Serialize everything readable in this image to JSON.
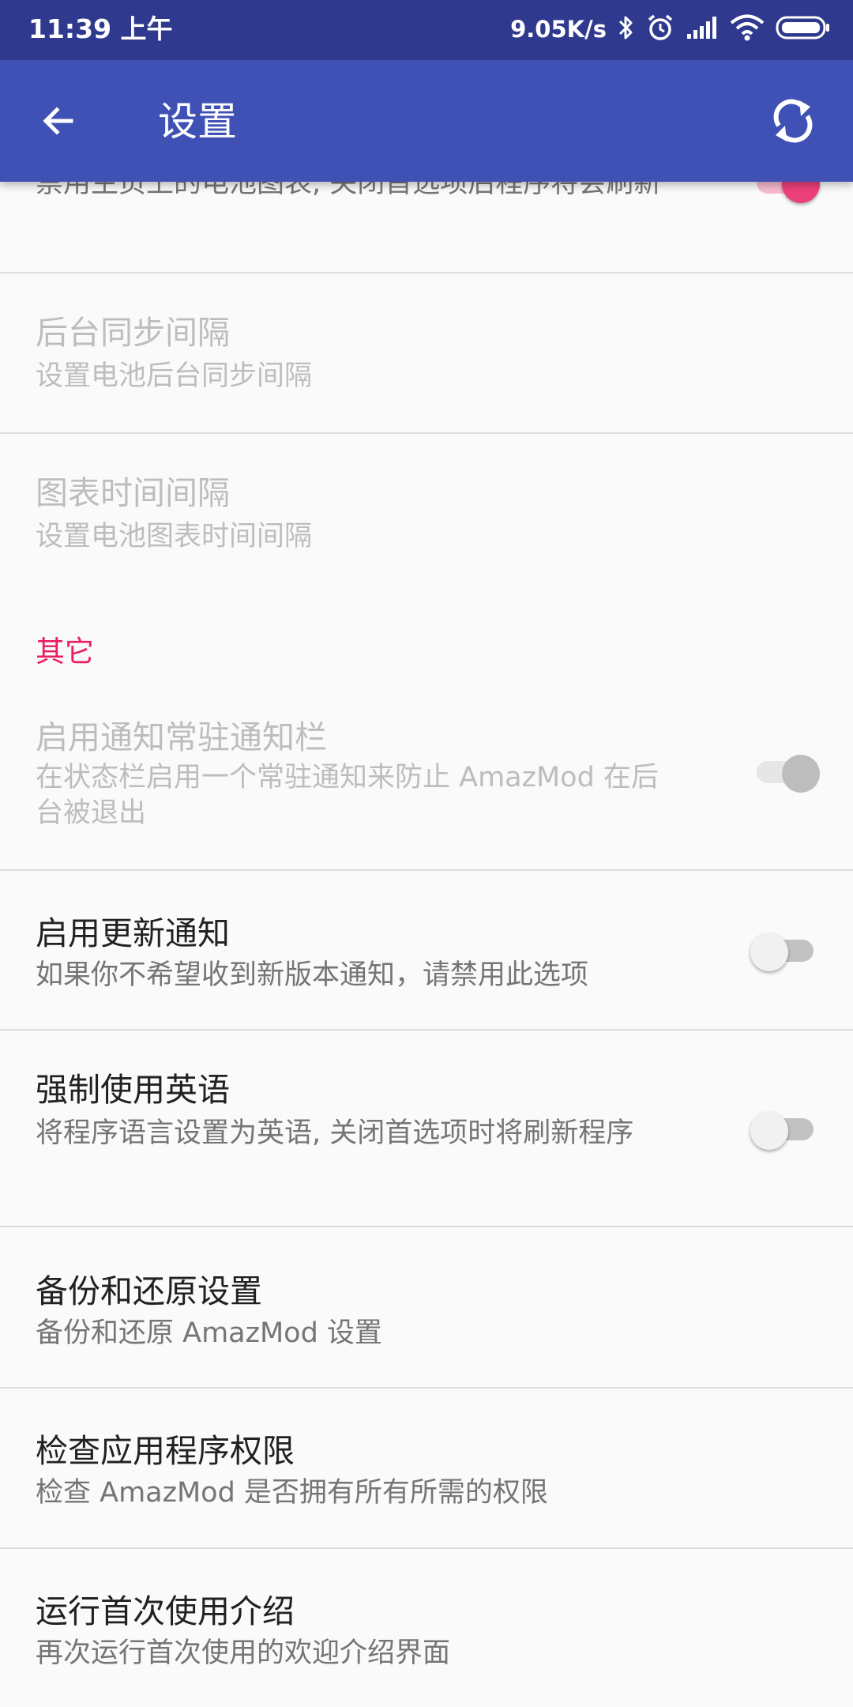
{
  "status_bar": {
    "time": "11:39 上午",
    "net_speed": "9.05K/s"
  },
  "app_bar": {
    "title": "设置"
  },
  "items": [
    {
      "summary": "禁用主页上的电池图表, 关闭首选项后程序将会刷新",
      "switch": "on",
      "enabled": true
    },
    {
      "title": "后台同步间隔",
      "summary": "设置电池后台同步间隔",
      "enabled": false
    },
    {
      "title": "图表时间间隔",
      "summary": "设置电池图表时间间隔",
      "enabled": false
    },
    {
      "title": "启用通知常驻通知栏",
      "summary": "在状态栏启用一个常驻通知来防止 AmazMod 在后台被退出",
      "switch": "on",
      "enabled": false
    },
    {
      "title": "启用更新通知",
      "summary": "如果你不希望收到新版本通知，请禁用此选项",
      "switch": "off",
      "enabled": true
    },
    {
      "title": "强制使用英语",
      "summary": "将程序语言设置为英语, 关闭首选项时将刷新程序",
      "switch": "off",
      "enabled": true
    },
    {
      "title": "备份和还原设置",
      "summary": "备份和还原 AmazMod 设置",
      "enabled": true
    },
    {
      "title": "检查应用程序权限",
      "summary": "检查 AmazMod 是否拥有所有所需的权限",
      "enabled": true
    },
    {
      "title": "运行首次使用介绍",
      "summary": "再次运行首次使用的欢迎介绍界面",
      "enabled": true
    }
  ],
  "category_other": "其它",
  "colors": {
    "status_bar": "#2f3a8f",
    "app_bar": "#3f51b5",
    "accent": "#e91e63",
    "background": "#fafafa"
  }
}
